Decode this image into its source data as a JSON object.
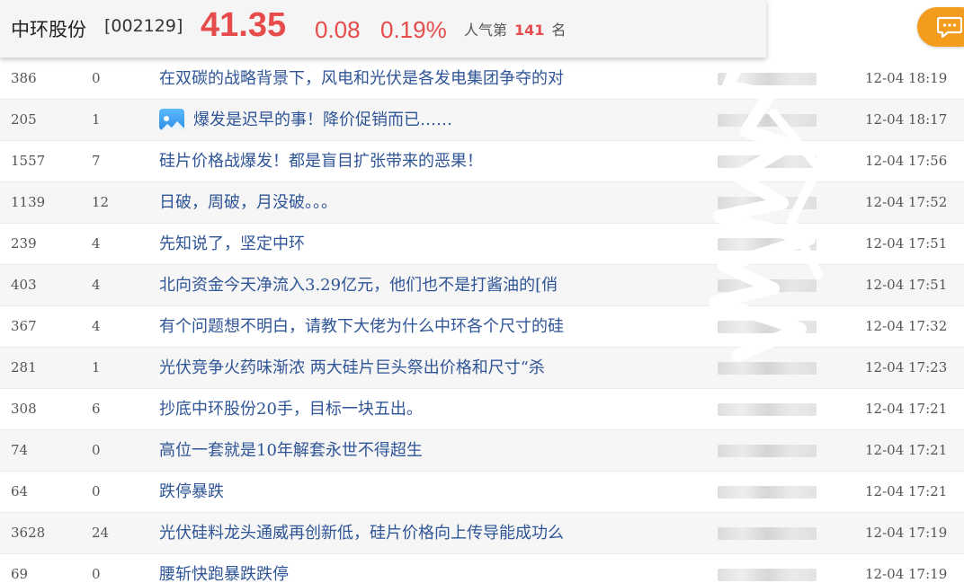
{
  "header": {
    "stock_name": "中环股份",
    "stock_code": "[002129]",
    "price": "41.35",
    "change": "0.08",
    "change_pct": "0.19%",
    "popularity_prefix": "人气第",
    "popularity_rank": "141",
    "popularity_suffix": "名"
  },
  "colors": {
    "up": "#e74c4c",
    "link": "#2f5597",
    "accent_button": "#f39c1e"
  },
  "posts": [
    {
      "reads": "386",
      "replies": "0",
      "title": "在双碳的战略背景下，风电和光伏是各发电集团争夺的对",
      "time": "12-04 18:19",
      "has_image": false
    },
    {
      "reads": "205",
      "replies": "1",
      "title": "爆发是迟早的事！降价促销而已……",
      "time": "12-04 18:17",
      "has_image": true
    },
    {
      "reads": "1557",
      "replies": "7",
      "title": "硅片价格战爆发！都是盲目扩张带来的恶果！",
      "time": "12-04 17:56",
      "has_image": false
    },
    {
      "reads": "1139",
      "replies": "12",
      "title": "日破，周破，月没破。。。",
      "time": "12-04 17:52",
      "has_image": false
    },
    {
      "reads": "239",
      "replies": "4",
      "title": "先知说了，坚定中环",
      "time": "12-04 17:51",
      "has_image": false
    },
    {
      "reads": "403",
      "replies": "4",
      "title": "北向资金今天净流入3.29亿元，他们也不是打酱油的[俏",
      "time": "12-04 17:51",
      "has_image": false
    },
    {
      "reads": "367",
      "replies": "4",
      "title": "有个问题想不明白，请教下大佬为什么中环各个尺寸的硅",
      "time": "12-04 17:32",
      "has_image": false
    },
    {
      "reads": "281",
      "replies": "1",
      "title": "光伏竞争火药味渐浓 两大硅片巨头祭出价格和尺寸“杀",
      "time": "12-04 17:23",
      "has_image": false
    },
    {
      "reads": "308",
      "replies": "6",
      "title": "抄底中环股份20手，目标一块五出。",
      "time": "12-04 17:21",
      "has_image": false
    },
    {
      "reads": "74",
      "replies": "0",
      "title": "高位一套就是10年解套永世不得超生",
      "time": "12-04 17:21",
      "has_image": false
    },
    {
      "reads": "64",
      "replies": "0",
      "title": "跌停暴跌",
      "time": "12-04 17:21",
      "has_image": false
    },
    {
      "reads": "3628",
      "replies": "24",
      "title": "光伏硅料龙头通威再创新低，硅片价格向上传导能成功么",
      "time": "12-04 17:19",
      "has_image": false
    },
    {
      "reads": "69",
      "replies": "0",
      "title": "腰斩快跑暴跌跌停",
      "time": "12-04 17:19",
      "has_image": false
    }
  ]
}
